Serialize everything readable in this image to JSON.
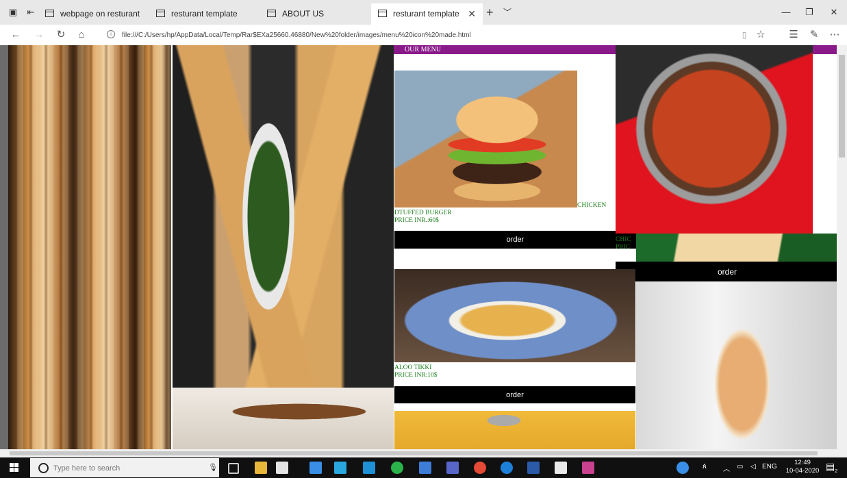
{
  "tabs": [
    {
      "title": "webpage on resturant"
    },
    {
      "title": "resturant template"
    },
    {
      "title": "ABOUT US"
    },
    {
      "title": "resturant template",
      "active": true
    }
  ],
  "address_bar": {
    "url": "file:///C:/Users/hp/AppData/Local/Temp/Rar$EXa25660.46880/New%20folder/images/menu%20icon%20made.html"
  },
  "page": {
    "menu_header": "OUR MENU",
    "items": [
      {
        "name": "DTUFFED BURGER",
        "price": "PRICE INR.:60$",
        "order": "order"
      },
      {
        "name": "CHICKEN",
        "name_cut": "CHIC",
        "price_cut": "PRIC",
        "order": "order"
      },
      {
        "name": "ALOO TIKKI",
        "price": "PRICE INR:10$",
        "order": "order"
      }
    ]
  },
  "taskbar": {
    "search_placeholder": "Type here to search",
    "language": "ENG",
    "time": "12:49",
    "date": "10-04-2020",
    "notification_count": "2"
  },
  "colors": {
    "menu_header_bg": "#8a1a8a",
    "item_text": "#1a7d1a",
    "order_bg": "#000000"
  }
}
